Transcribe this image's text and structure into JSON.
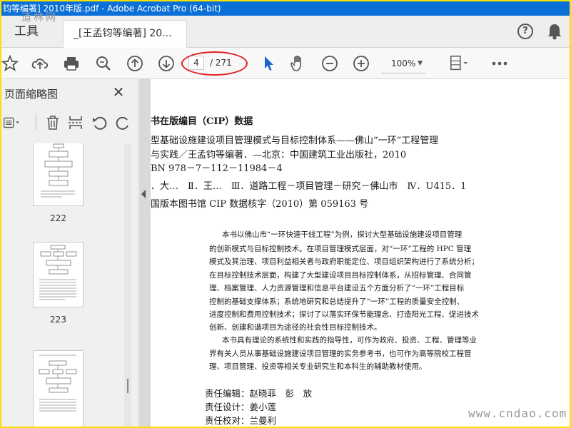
{
  "window": {
    "title": "钧等编著] 2010年版.pdf - Adobe Acrobat Pro (64-bit)"
  },
  "tabs": {
    "tools": "工具",
    "document": "_[王孟钧等编著] 20..."
  },
  "toolbar": {
    "current_page": "4",
    "total_pages": "/ 271",
    "zoom": "100%",
    "icons": [
      "star-icon",
      "cloud-upload-icon",
      "print-icon",
      "zoom-search-icon",
      "page-up-icon",
      "page-down-icon",
      "select-arrow-icon",
      "hand-icon",
      "zoom-out-icon",
      "zoom-in-icon",
      "fit-page-icon",
      "more-icon"
    ]
  },
  "sidebar": {
    "title": "页面缩略图",
    "thumbnails": [
      {
        "label": "222"
      },
      {
        "label": "223"
      },
      {
        "label": ""
      }
    ]
  },
  "page": {
    "cip_title": "书在版编目（CIP）数据",
    "cip_lines": [
      "型基础设施建设项目管理模式与目标控制体系——佛山“一环”工程管理",
      "与实践／王孟钧等编著．—北京：中国建筑工业出版社，2010",
      "BN 978－7－112－11984－4",
      "．大…　Ⅱ．王…　Ⅲ．道路工程－项目管理－研究－佛山市　Ⅳ．U415．1",
      "国版本图书馆 CIP 数据核字（2010）第 059163 号"
    ],
    "abstract_lines": [
      "本书以佛山市“一环快速干线工程”为例，探讨大型基础设施建设项目管理",
      "的创新模式与目标控制技术。在项目管理模式层面，对“一环”工程的 HPC 管理",
      "模式及其治理、项目利益相关者与政府职能定位、项目组织架构进行了系统分析；",
      "在目标控制技术层面，构建了大型建设项目目标控制体系，从招标管理、合同管",
      "理、档案管理、人力资源管理和信息平台建设五个方面分析了“一环”工程目标",
      "控制的基础支撑体系；系统地研究和总结提升了“一环”工程的质量安全控制、",
      "进度控制和费用控制技术；探讨了以落实环保节能理念、打造阳光工程、促进技术",
      "创新、创建和谐项目为途径的社会性目标控制技术。",
      "本书具有理论的系统性和实践的指导性，可作为政府、投资、工程、管理等业",
      "界有关人员从事基础设施建设项目管理的实务参考书，也可作为高等院校工程管",
      "理、项目管理、投资等相关专业研究生和本科生的辅助教材使用。"
    ],
    "credits": [
      "责任编辑：赵晓菲　彭　放",
      "责任设计：姜小莲",
      "责任校对：兰曼利"
    ]
  },
  "watermarks": {
    "logo": "道林网",
    "site": "www.cndao.com"
  },
  "colors": {
    "titlebar": "#0a6fd6",
    "frame": "#f7e200",
    "highlight": "#e02020",
    "select_tool": "#1a66cc"
  }
}
